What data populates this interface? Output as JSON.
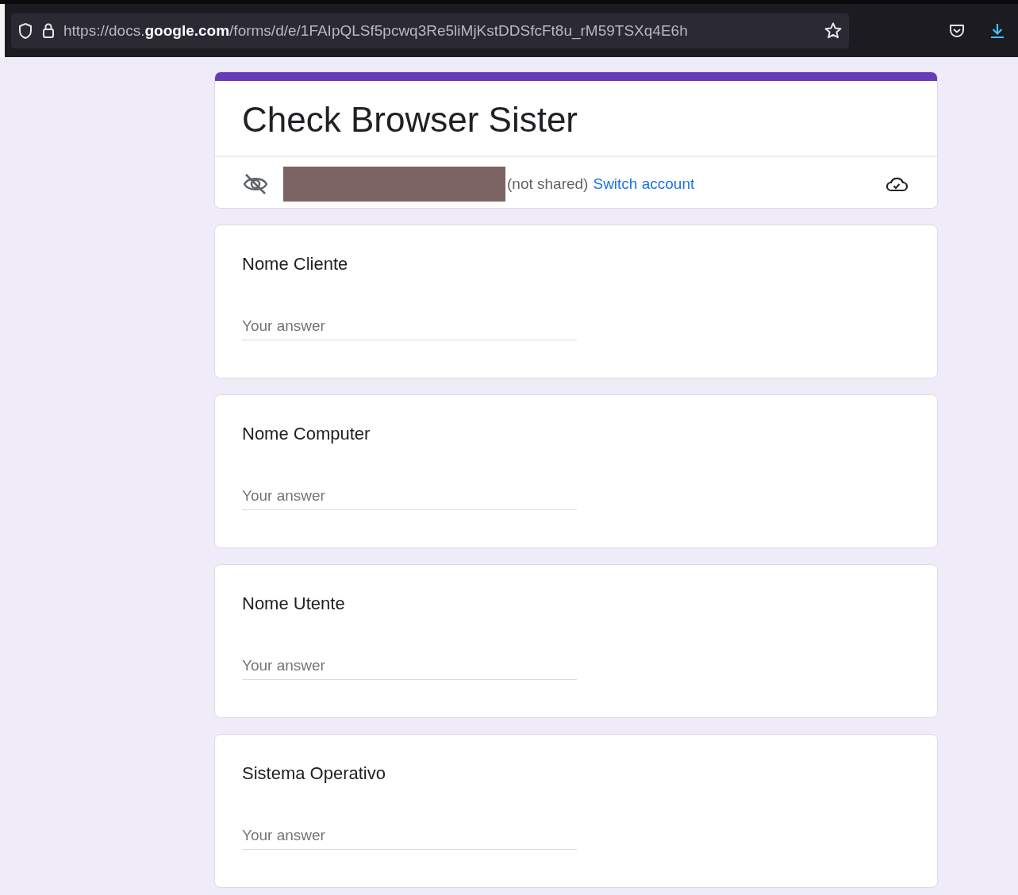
{
  "browser": {
    "url": "https://docs.**google.com**/forms/d/e/1FAIpQLSf5pcwq3Re5liMjKstDDSfcFt8u_rM59TSXq4E6h"
  },
  "form": {
    "title": "Check Browser Sister",
    "account_note": "(not shared)",
    "switch_link": "Switch account"
  },
  "questions": [
    {
      "label": "Nome Cliente",
      "placeholder": "Your answer"
    },
    {
      "label": "Nome Computer",
      "placeholder": "Your answer"
    },
    {
      "label": "Nome Utente",
      "placeholder": "Your answer"
    },
    {
      "label": "Sistema Operativo",
      "placeholder": "Your answer"
    }
  ]
}
